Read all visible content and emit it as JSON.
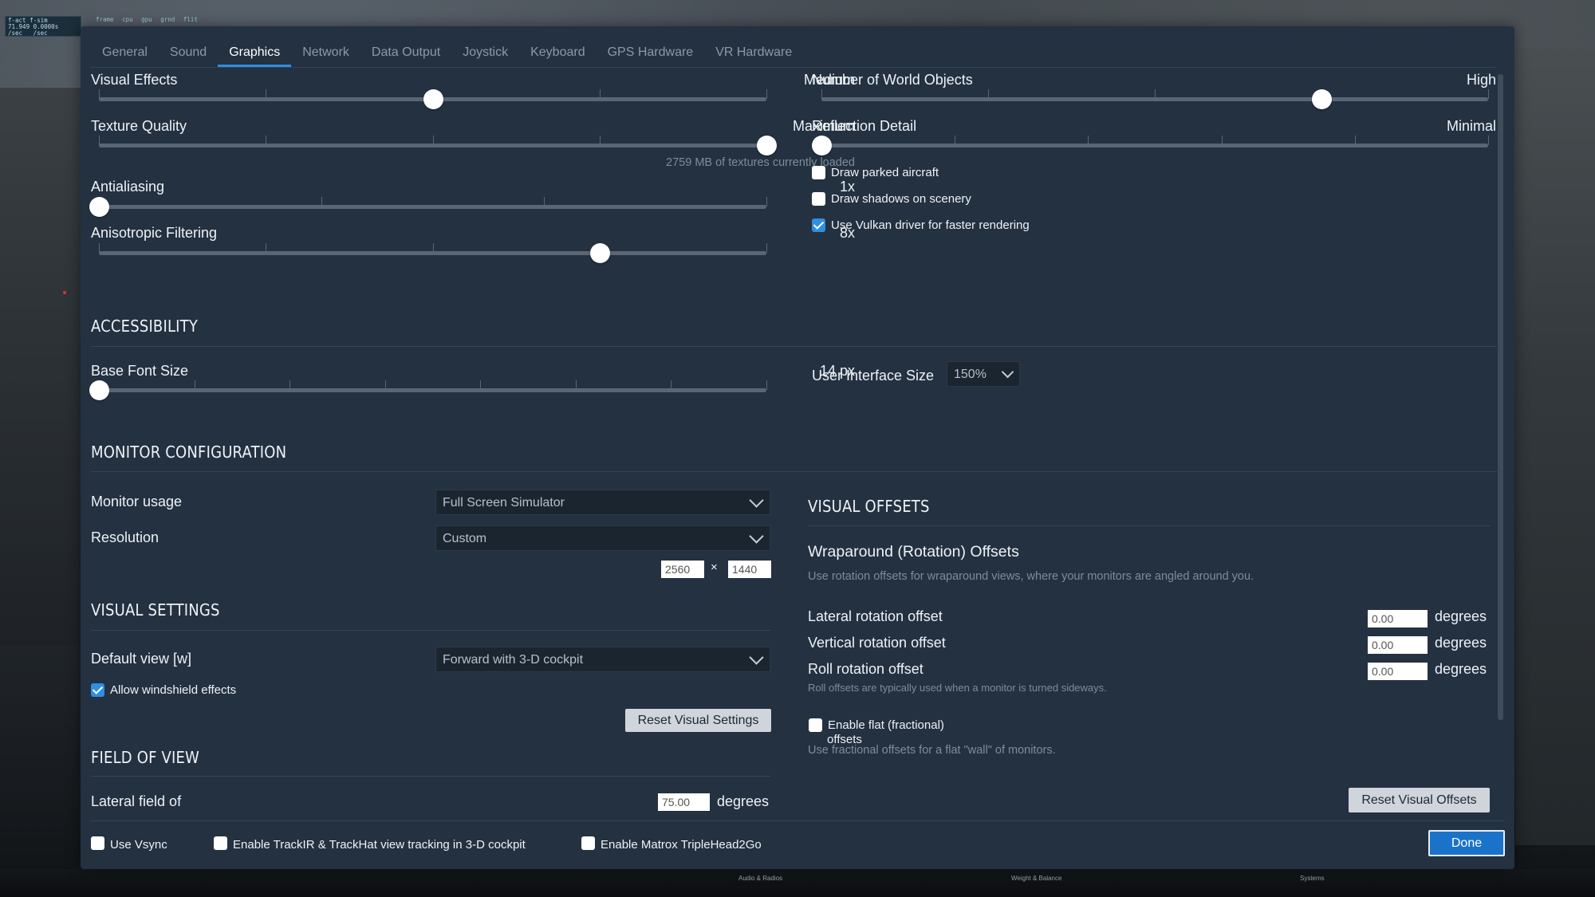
{
  "hud": {
    "top_labels": "frame cpu gpu grnd flit",
    "stats": "f-act f-sim\n71.949 0.0000s\n/sec   /sec"
  },
  "bottom_labels": [
    "Audio & Radios",
    "Weight & Balance",
    "Systems"
  ],
  "tabs": [
    "General",
    "Sound",
    "Graphics",
    "Network",
    "Data Output",
    "Joystick",
    "Keyboard",
    "GPS Hardware",
    "VR Hardware"
  ],
  "graphics": {
    "visual_effects": {
      "label": "Visual Effects",
      "value": "Medium",
      "level": 0.5
    },
    "texture_quality": {
      "label": "Texture Quality",
      "value": "Maximum",
      "level": 1.0,
      "note": "2759 MB of textures currently loaded"
    },
    "antialiasing": {
      "label": "Antialiasing",
      "value": "1x",
      "level": 0.0
    },
    "anisotropic": {
      "label": "Anisotropic Filtering",
      "value": "8x",
      "level": 0.75
    },
    "world_objects": {
      "label": "Number of World Objects",
      "value": "High",
      "level": 0.75
    },
    "reflection": {
      "label": "Reflection Detail",
      "value": "Minimal",
      "level": 0.0
    },
    "draw_parked_aircraft": {
      "label": "Draw parked aircraft",
      "checked": false
    },
    "draw_shadows": {
      "label": "Draw shadows on scenery",
      "checked": false
    },
    "use_vulkan": {
      "label": "Use Vulkan driver for faster rendering",
      "checked": true
    }
  },
  "accessibility": {
    "title": "ACCESSIBILITY",
    "base_font": {
      "label": "Base Font Size",
      "value": "14 px",
      "level": 0.0
    },
    "ui_size": {
      "label": "User Interface Size",
      "value": "150%"
    }
  },
  "monitor": {
    "title": "MONITOR CONFIGURATION",
    "usage": {
      "label": "Monitor usage",
      "value": "Full Screen Simulator"
    },
    "resolution": {
      "label": "Resolution",
      "value": "Custom",
      "width": "2560",
      "height": "1440",
      "separator": "×"
    }
  },
  "visual_settings": {
    "title": "VISUAL SETTINGS",
    "default_view": {
      "label": "Default view [w]",
      "value": "Forward with 3-D cockpit"
    },
    "windshield": {
      "label": "Allow windshield effects",
      "checked": true
    },
    "reset_label": "Reset Visual Settings"
  },
  "fov": {
    "title": "FIELD OF VIEW",
    "lateral": {
      "label": "Lateral field of",
      "value": "75.00",
      "unit": "degrees"
    }
  },
  "visual_offsets": {
    "title": "VISUAL OFFSETS",
    "wrap_title": "Wraparound (Rotation) Offsets",
    "wrap_desc": "Use rotation offsets for wraparound views, where your monitors are angled around you.",
    "lateral": {
      "label": "Lateral rotation offset",
      "value": "0.00",
      "unit": "degrees"
    },
    "vertical": {
      "label": "Vertical rotation offset",
      "value": "0.00",
      "unit": "degrees"
    },
    "roll": {
      "label": "Roll rotation offset",
      "value": "0.00",
      "unit": "degrees"
    },
    "roll_note": "Roll offsets are typically used when a monitor is turned sideways.",
    "flat": {
      "label_line1": "Enable flat (fractional)",
      "label_line2": "offsets",
      "checked": false
    },
    "flat_desc": "Use fractional offsets for a flat \"wall\" of monitors.",
    "reset_label": "Reset Visual Offsets"
  },
  "footer": {
    "vsync": {
      "label": "Use Vsync",
      "checked": false
    },
    "trackir": {
      "label": "Enable TrackIR & TrackHat view tracking in 3-D cockpit",
      "checked": false
    },
    "matrox": {
      "label": "Enable Matrox TripleHead2Go",
      "checked": false
    },
    "done_label": "Done"
  },
  "colors": {
    "dialog_bg": "#233141",
    "accent": "#2f8fe0",
    "done_button": "#1a73c9"
  }
}
